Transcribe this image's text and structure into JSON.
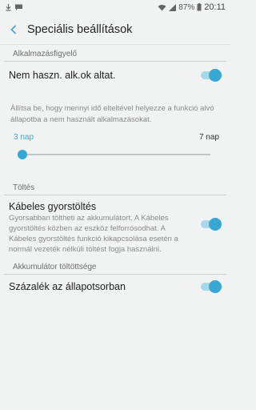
{
  "status_bar": {
    "battery": "87%",
    "time": "20:11"
  },
  "header": {
    "title": "Speciális beállítások"
  },
  "sections": {
    "app_monitor": {
      "header": "Alkalmazásfigyelő",
      "setting_label": "Nem haszn. alk.ok altat.",
      "toggle_on": true,
      "description": "Állítsa be, hogy mennyi idő elteltével helyezze a funkció alvó állapotba a nem használt alkalmazásokat.",
      "slider": {
        "min_label": "3 nap",
        "max_label": "7 nap",
        "position": 0
      }
    },
    "charging": {
      "header": "Töltés",
      "setting_label": "Kábeles gyorstöltés",
      "description": "Gyorsabban töltheti az akkumulátort. A Kábeles gyorstöltés közben az eszköz felforrósodhat. A Kábeles gyorstöltés funkció kikapcsolása esetén a normál vezeték nélküli töltést fogja használni.",
      "toggle_on": true
    },
    "battery_level": {
      "header": "Akkumulátor töltöttsége",
      "setting_label": "Százalék az állapotsorban",
      "toggle_on": true
    }
  },
  "colors": {
    "accent": "#3aa6d4",
    "track": "#a8d6ea",
    "background": "#f1f2f2"
  }
}
